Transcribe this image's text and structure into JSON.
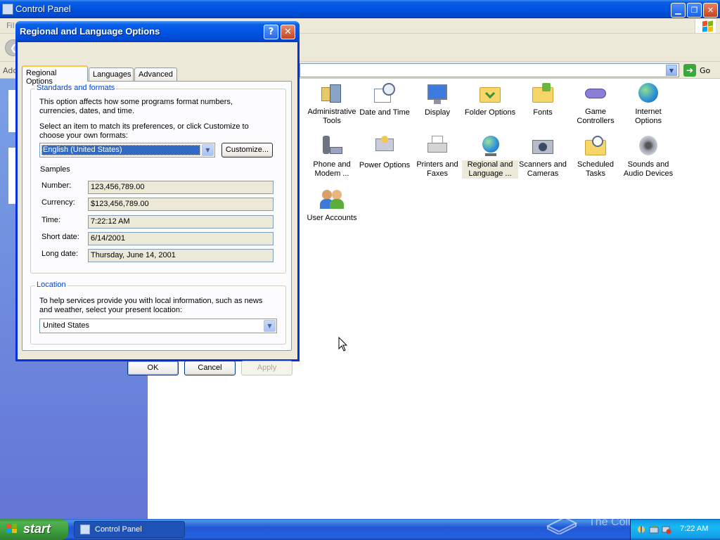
{
  "control_panel": {
    "title": "Control Panel",
    "menu_file": "Fil",
    "address_label": "Add",
    "go_label": "Go",
    "icons": [
      {
        "label": "Administrative Tools"
      },
      {
        "label": "Date and Time"
      },
      {
        "label": "Display"
      },
      {
        "label": "Folder Options"
      },
      {
        "label": "Fonts"
      },
      {
        "label": "Game Controllers"
      },
      {
        "label": "Internet Options"
      },
      {
        "label": "Phone and Modem ..."
      },
      {
        "label": "Power Options"
      },
      {
        "label": "Printers and Faxes"
      },
      {
        "label": "Regional and Language ...",
        "selected": true
      },
      {
        "label": "Scanners and Cameras"
      },
      {
        "label": "Scheduled Tasks"
      },
      {
        "label": "Sounds and Audio Devices"
      },
      {
        "label": "User Accounts"
      }
    ]
  },
  "dialog": {
    "title": "Regional and Language Options",
    "help_glyph": "?",
    "close_glyph": "✕",
    "tabs": [
      "Regional Options",
      "Languages",
      "Advanced"
    ],
    "standards": {
      "group_title": "Standards and formats",
      "description": "This option affects how some programs format numbers, currencies, dates, and time.",
      "instruction": "Select an item to match its preferences, or click Customize to choose your own formats:",
      "selected_format": "English (United States)",
      "customize_label": "Customize...",
      "samples_label": "Samples",
      "samples": [
        {
          "label": "Number:",
          "value": "123,456,789.00"
        },
        {
          "label": "Currency:",
          "value": "$123,456,789.00"
        },
        {
          "label": "Time:",
          "value": "7:22:12 AM"
        },
        {
          "label": "Short date:",
          "value": "6/14/2001"
        },
        {
          "label": "Long date:",
          "value": "Thursday, June 14, 2001"
        }
      ]
    },
    "location": {
      "group_title": "Location",
      "description": "To help services provide you with local information, such as news and weather, select your present location:",
      "selected_location": "United States"
    },
    "buttons": {
      "ok": "OK",
      "cancel": "Cancel",
      "apply": "Apply"
    }
  },
  "taskbar": {
    "start_label": "start",
    "task_label": "Control Panel",
    "clock": "7:22 AM",
    "watermark": "The Collection Book"
  },
  "colors": {
    "title_blue": "#0054e3",
    "selection_blue": "#316ac5",
    "dialog_face": "#ece9d8",
    "group_title": "#0046d5",
    "start_green": "#3a9e3a"
  }
}
